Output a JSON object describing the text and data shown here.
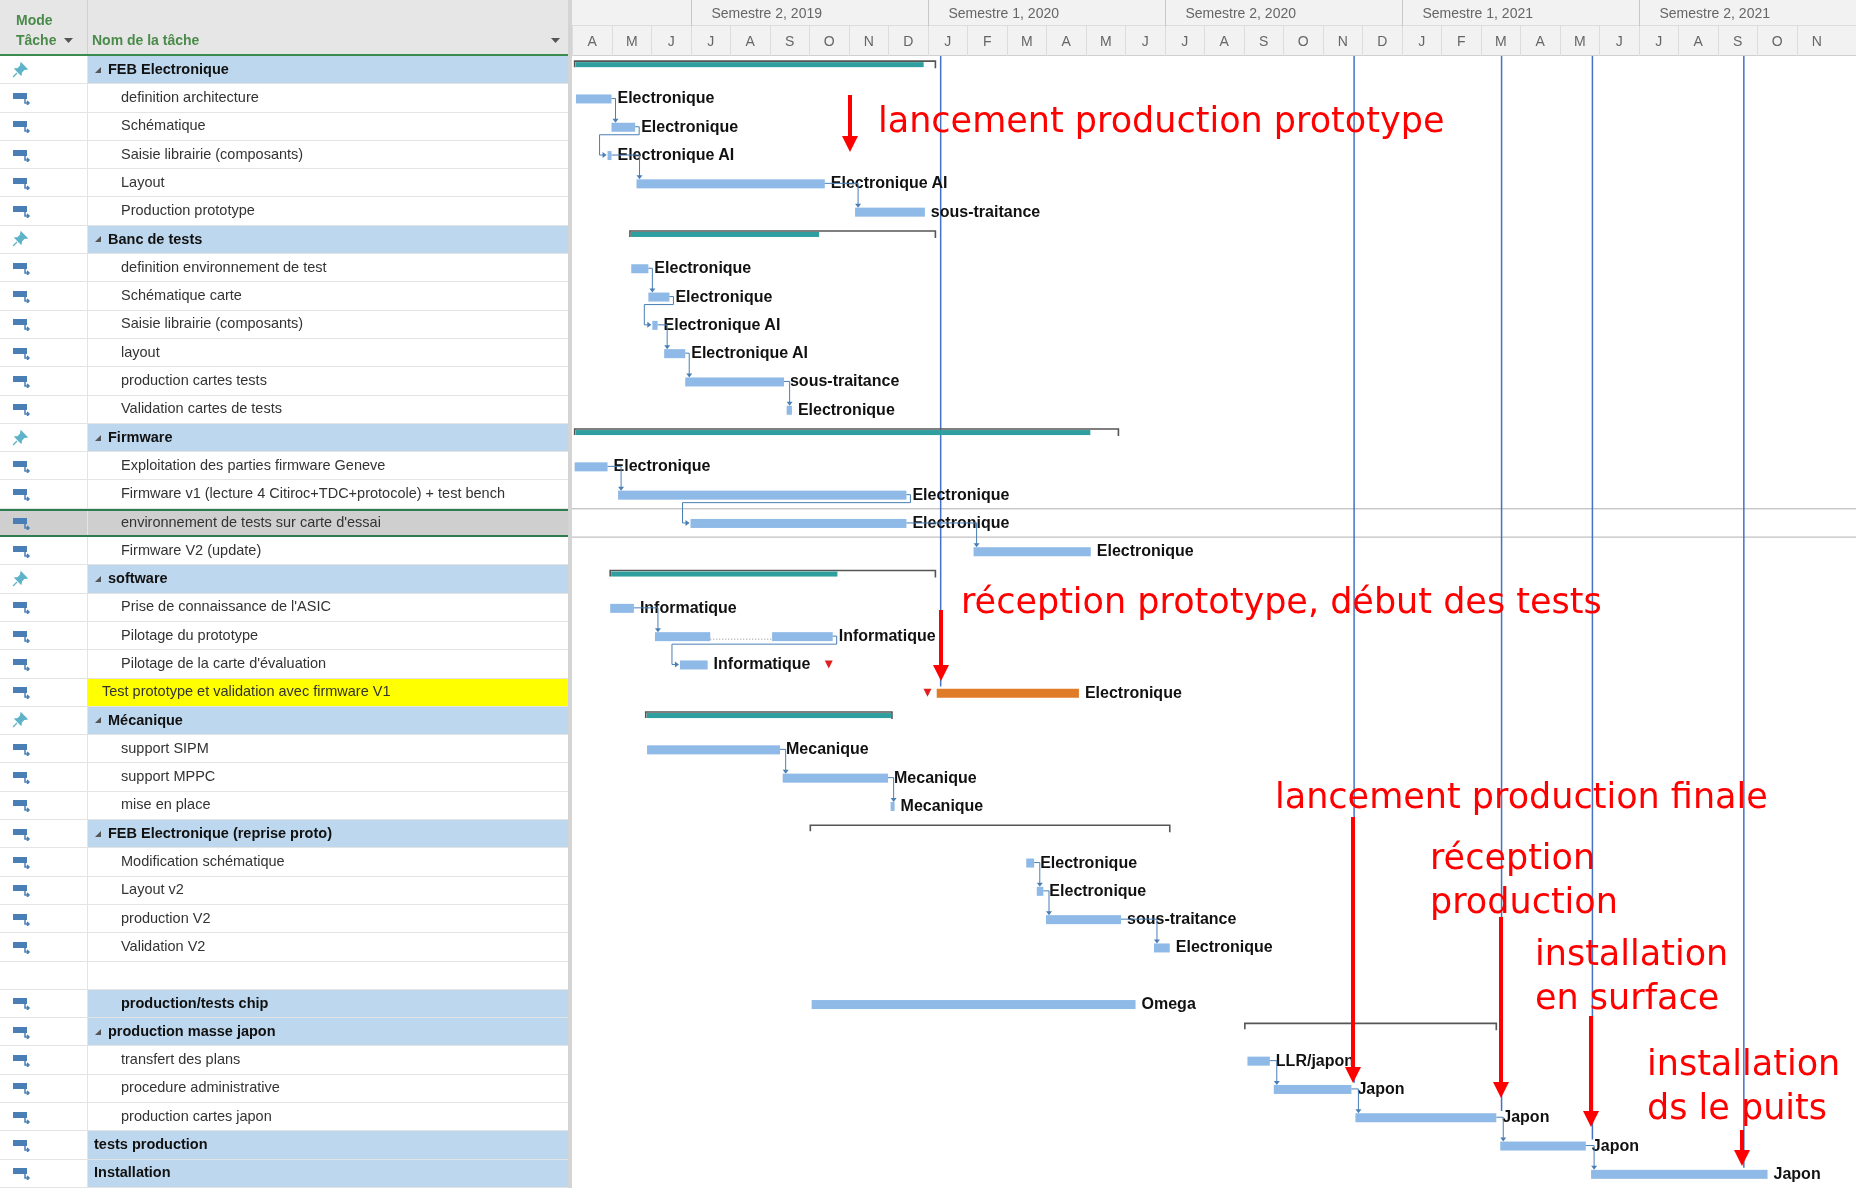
{
  "table": {
    "columns": [
      {
        "label": "Mode Tâche"
      },
      {
        "label": "Nom de la tâche"
      }
    ]
  },
  "timeline": {
    "semesters": [
      {
        "label": "Semestre 2, 2019"
      },
      {
        "label": "Semestre 1, 2020"
      },
      {
        "label": "Semestre 2, 2020"
      },
      {
        "label": "Semestre 1, 2021"
      },
      {
        "label": "Semestre 2, 2021"
      }
    ],
    "months": [
      "A",
      "M",
      "J",
      "J",
      "A",
      "S",
      "O",
      "N",
      "D",
      "J",
      "F",
      "M",
      "A",
      "M",
      "J",
      "J",
      "A",
      "S",
      "O",
      "N",
      "D",
      "J",
      "F",
      "M",
      "A",
      "M",
      "J",
      "J",
      "A",
      "S",
      "O",
      "N"
    ]
  },
  "rows": [
    {
      "pinned": true,
      "kind": "group",
      "expanded": true,
      "name": "FEB Electronique",
      "selected": false,
      "highlighted": false,
      "bar": {
        "kind": "summary",
        "level": 0.97
      }
    },
    {
      "pinned": false,
      "kind": "task",
      "name": "definition architecture",
      "selected": false,
      "highlighted": false,
      "bar": {
        "kind": "task",
        "critical": false,
        "link": false,
        "label": "Electronique"
      }
    },
    {
      "pinned": false,
      "kind": "task",
      "name": "Schématique",
      "selected": false,
      "highlighted": false,
      "bar": {
        "kind": "task",
        "critical": false,
        "link": true,
        "label": "Electronique"
      }
    },
    {
      "pinned": false,
      "kind": "task",
      "name": "Saisie librairie (composants)",
      "selected": false,
      "highlighted": false,
      "bar": {
        "kind": "task",
        "critical": false,
        "link": true,
        "label": "Electronique AI"
      }
    },
    {
      "pinned": false,
      "kind": "task",
      "name": "Layout",
      "selected": false,
      "highlighted": false,
      "bar": {
        "kind": "task",
        "critical": false,
        "link": true,
        "label": "Electronique AI"
      }
    },
    {
      "pinned": false,
      "kind": "task",
      "name": "Production prototype",
      "selected": false,
      "highlighted": false,
      "bar": {
        "kind": "task",
        "critical": false,
        "link": true,
        "label": "sous-traitance"
      }
    },
    {
      "pinned": true,
      "kind": "group",
      "expanded": true,
      "name": "Banc de tests",
      "selected": false,
      "highlighted": false,
      "bar": {
        "kind": "summary",
        "level": 0.62
      }
    },
    {
      "pinned": false,
      "kind": "task",
      "name": "definition environnement de test",
      "selected": false,
      "highlighted": false,
      "bar": {
        "kind": "task",
        "critical": false,
        "link": false,
        "label": "Electronique"
      }
    },
    {
      "pinned": false,
      "kind": "task",
      "name": "Schématique carte",
      "selected": false,
      "highlighted": false,
      "bar": {
        "kind": "task",
        "critical": false,
        "link": true,
        "label": "Electronique"
      }
    },
    {
      "pinned": false,
      "kind": "task",
      "name": "Saisie librairie (composants)",
      "selected": false,
      "highlighted": false,
      "bar": {
        "kind": "task",
        "critical": false,
        "link": true,
        "label": "Electronique AI"
      }
    },
    {
      "pinned": false,
      "kind": "task",
      "name": "layout",
      "selected": false,
      "highlighted": false,
      "bar": {
        "kind": "task",
        "critical": false,
        "link": true,
        "label": "Electronique AI"
      }
    },
    {
      "pinned": false,
      "kind": "task",
      "name": "production cartes tests",
      "selected": false,
      "highlighted": false,
      "bar": {
        "kind": "task",
        "critical": false,
        "link": true,
        "label": "sous-traitance"
      }
    },
    {
      "pinned": false,
      "kind": "task",
      "name": "Validation cartes de tests",
      "selected": false,
      "highlighted": false,
      "bar": {
        "kind": "task",
        "critical": false,
        "link": true,
        "label": "Electronique"
      }
    },
    {
      "pinned": true,
      "kind": "group",
      "expanded": true,
      "name": "Firmware",
      "selected": false,
      "highlighted": false,
      "bar": {
        "kind": "summary",
        "level": 0.95
      }
    },
    {
      "pinned": false,
      "kind": "task",
      "name": "Exploitation des parties firmware Geneve",
      "selected": false,
      "highlighted": false,
      "bar": {
        "kind": "task",
        "critical": false,
        "link": false,
        "label": "Electronique"
      }
    },
    {
      "pinned": false,
      "kind": "task",
      "name": "Firmware v1 (lecture 4 Citiroc+TDC+protocole) + test bench",
      "selected": false,
      "highlighted": false,
      "bar": {
        "kind": "task",
        "critical": false,
        "link": true,
        "label": "Electronique"
      }
    },
    {
      "pinned": false,
      "kind": "task",
      "name": "environnement de tests sur carte d'essai",
      "selected": true,
      "highlighted": false,
      "bar": {
        "kind": "task",
        "critical": false,
        "link": true,
        "label": "Electronique"
      }
    },
    {
      "pinned": false,
      "kind": "task",
      "name": "Firmware V2 (update)",
      "selected": false,
      "highlighted": false,
      "bar": {
        "kind": "task",
        "critical": false,
        "link": true,
        "label": "Electronique"
      }
    },
    {
      "pinned": true,
      "kind": "group",
      "expanded": true,
      "name": "software",
      "selected": false,
      "highlighted": false,
      "bar": {
        "kind": "summary",
        "level": 0.7
      }
    },
    {
      "pinned": false,
      "kind": "task",
      "name": "Prise de connaissance de l'ASIC",
      "selected": false,
      "highlighted": false,
      "bar": {
        "kind": "task",
        "critical": false,
        "link": false,
        "label": "Informatique"
      }
    },
    {
      "pinned": false,
      "kind": "task",
      "name": "Pilotage du prototype",
      "selected": false,
      "highlighted": false,
      "bar": {
        "kind": "task",
        "critical": false,
        "link": true,
        "label": "Informatique"
      }
    },
    {
      "pinned": false,
      "kind": "task",
      "name": "Pilotage de la carte d'évaluation",
      "selected": false,
      "highlighted": false,
      "bar": {
        "kind": "task",
        "critical": false,
        "link": true,
        "deadline": true,
        "label": "Informatique"
      }
    },
    {
      "pinned": false,
      "kind": "task",
      "name": "Test prototype et validation avec firmware V1",
      "selected": false,
      "highlighted": true,
      "bar": {
        "kind": "task",
        "critical": true,
        "link": false,
        "deadline": true,
        "label": "Electronique"
      }
    },
    {
      "pinned": true,
      "kind": "group",
      "expanded": true,
      "name": "Mécanique",
      "selected": false,
      "highlighted": false,
      "bar": {
        "kind": "summary",
        "level": 1
      }
    },
    {
      "pinned": false,
      "kind": "task",
      "name": "support SIPM",
      "selected": false,
      "highlighted": false,
      "bar": {
        "kind": "task",
        "critical": false,
        "link": false,
        "label": "Mecanique"
      }
    },
    {
      "pinned": false,
      "kind": "task",
      "name": "support MPPC",
      "selected": false,
      "highlighted": false,
      "bar": {
        "kind": "task",
        "critical": false,
        "link": true,
        "label": "Mecanique"
      }
    },
    {
      "pinned": false,
      "kind": "task",
      "name": "mise en place",
      "selected": false,
      "highlighted": false,
      "bar": {
        "kind": "task",
        "critical": false,
        "link": true,
        "label": "Mecanique"
      }
    },
    {
      "pinned": false,
      "kind": "group",
      "expanded": true,
      "name": "FEB Electronique (reprise proto)",
      "selected": false,
      "highlighted": false,
      "bar": {
        "kind": "summary"
      }
    },
    {
      "pinned": false,
      "kind": "task",
      "name": "Modification schématique",
      "selected": false,
      "highlighted": false,
      "bar": {
        "kind": "task",
        "critical": false,
        "link": false,
        "label": "Electronique"
      }
    },
    {
      "pinned": false,
      "kind": "task",
      "name": "Layout v2",
      "selected": false,
      "highlighted": false,
      "bar": {
        "kind": "task",
        "critical": false,
        "link": true,
        "label": "Electronique"
      }
    },
    {
      "pinned": false,
      "kind": "task",
      "name": "production V2",
      "selected": false,
      "highlighted": false,
      "bar": {
        "kind": "task",
        "critical": false,
        "link": true,
        "label": "sous-traitance"
      }
    },
    {
      "pinned": false,
      "kind": "task",
      "name": "Validation V2",
      "selected": false,
      "highlighted": false,
      "bar": {
        "kind": "task",
        "critical": false,
        "link": true,
        "label": "Electronique"
      }
    },
    {
      "kind": "blank",
      "selected": false,
      "highlighted": false
    },
    {
      "pinned": false,
      "kind": "bold_task",
      "name": "production/tests chip",
      "selected": false,
      "highlighted": false,
      "bar": {
        "kind": "task",
        "critical": false,
        "link": false,
        "label": "Omega"
      }
    },
    {
      "pinned": false,
      "kind": "group",
      "expanded": true,
      "name": "production masse japon",
      "selected": false,
      "highlighted": false,
      "bar": {
        "kind": "summary"
      }
    },
    {
      "pinned": false,
      "kind": "task",
      "name": "transfert des plans",
      "selected": false,
      "highlighted": false,
      "bar": {
        "kind": "task",
        "critical": false,
        "link": false,
        "label": "LLR/japon"
      }
    },
    {
      "pinned": false,
      "kind": "task",
      "name": "procedure administrative",
      "selected": false,
      "highlighted": false,
      "bar": {
        "kind": "task",
        "critical": false,
        "link": true,
        "label": "Japon"
      }
    },
    {
      "pinned": false,
      "kind": "task",
      "name": "production cartes japon",
      "selected": false,
      "highlighted": false,
      "bar": {
        "kind": "task",
        "critical": false,
        "link": true,
        "label": "Japon"
      }
    },
    {
      "pinned": false,
      "kind": "summary",
      "name": "tests production",
      "selected": false,
      "highlighted": false,
      "bar": {
        "kind": "task",
        "critical": false,
        "link": true,
        "label": "Japon"
      }
    },
    {
      "pinned": false,
      "kind": "summary",
      "name": "Installation",
      "selected": false,
      "highlighted": false,
      "bar": {
        "kind": "task",
        "critical": false,
        "link": true,
        "label": "Japon"
      }
    }
  ],
  "annotations": [
    {
      "lines": [
        "lancement production prototype"
      ]
    },
    {
      "lines": [
        "réception prototype, début des tests"
      ]
    },
    {
      "lines": [
        "lancement production finale"
      ]
    },
    {
      "lines": [
        "réception",
        "production"
      ]
    },
    {
      "lines": [
        "installation",
        "en surface"
      ]
    },
    {
      "lines": [
        "installation",
        "ds le puits"
      ]
    }
  ]
}
